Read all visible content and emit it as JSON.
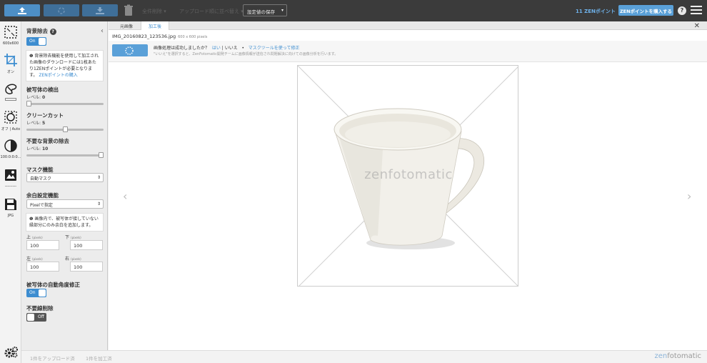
{
  "topbar": {
    "upload_icon": "upload-icon",
    "refresh_icon": "refresh-icon",
    "download_icon": "download-icon",
    "trash_icon": "trash-icon",
    "dim_text_1": "全件削除 ▾",
    "dim_text_2": "アップロード順に並べ替え ▾",
    "settings_save": "設定値の保存",
    "zen_points": "11 ZENポイント",
    "buy_points": "ZENポイントを購入する",
    "help": "?"
  },
  "rail": {
    "items": [
      {
        "icon": "canvas-size-icon",
        "label": "600x600"
      },
      {
        "icon": "crop-icon",
        "label": "オン"
      },
      {
        "icon": "color-picker-icon",
        "label": ""
      },
      {
        "icon": "auto-adjust-icon",
        "label": "オフ | Auto"
      },
      {
        "icon": "contrast-icon",
        "label": "100:0:0:0..."
      },
      {
        "icon": "image-effect-icon",
        "label": "---------"
      },
      {
        "icon": "save-format-icon",
        "label": "JPG"
      }
    ]
  },
  "panel": {
    "bg_removal": {
      "title": "背景除去",
      "toggle": "On"
    },
    "info": {
      "text": "背景除去機能を使用して加工された画像のダウンロードには1枚あたり1ZENポイントが必要となります。",
      "link": "ZENポイントの購入"
    },
    "subject_detect": {
      "title": "被写体の検出",
      "level_label": "レベル:",
      "level": "0",
      "fraction": 0.0
    },
    "clean_cut": {
      "title": "クリーンカット",
      "level_label": "レベル:",
      "level": "5",
      "fraction": 0.5
    },
    "unwanted_bg": {
      "title": "不要な背景の除去",
      "level_label": "レベル:",
      "level": "10",
      "fraction": 1.0
    },
    "mask": {
      "title": "マスク機能",
      "value": "自動マスク"
    },
    "margin": {
      "title": "余白設定機能",
      "value": "Pixelで指定",
      "info": "画像内で、被写体が接していない縁部分にのみ余白を追加します。"
    },
    "margins": {
      "top_label": "上",
      "bottom_label": "下",
      "left_label": "左",
      "right_label": "右",
      "unit": "(pixels)",
      "top": "100",
      "bottom": "100",
      "left": "100",
      "right": "100"
    },
    "auto_angle": {
      "title": "被写体の自動角度修正",
      "toggle": "On"
    },
    "line_removal": {
      "title": "不要線削除",
      "toggle": "Off"
    }
  },
  "main": {
    "tabs": [
      {
        "label": "元画像"
      },
      {
        "label": "加工後"
      }
    ],
    "active_tab": 1,
    "file_name": "IMG_20160823_123536.jpg",
    "file_dims": "600 x 600 pixels",
    "question": "画像処理は成功しましたか？",
    "yes": "はい",
    "sep": "|",
    "no": "いいえ",
    "dot": "•",
    "mask_fix": "マスクツールを使って修正",
    "note": "\"いいえ\"を選択すると、ZenFotomatic開発チームに画像情報が送信され問題解決に向けての画像分析を行います。",
    "watermark": "zenfotomatic"
  },
  "footer": {
    "uploaded": "1件をアップロード済",
    "processed": "1件を加工済",
    "brand_a": "zen",
    "brand_b": "fotomatic"
  },
  "colors": {
    "accent": "#3d8dd0",
    "topbar": "#3b3b3b",
    "panel": "#ececec"
  }
}
